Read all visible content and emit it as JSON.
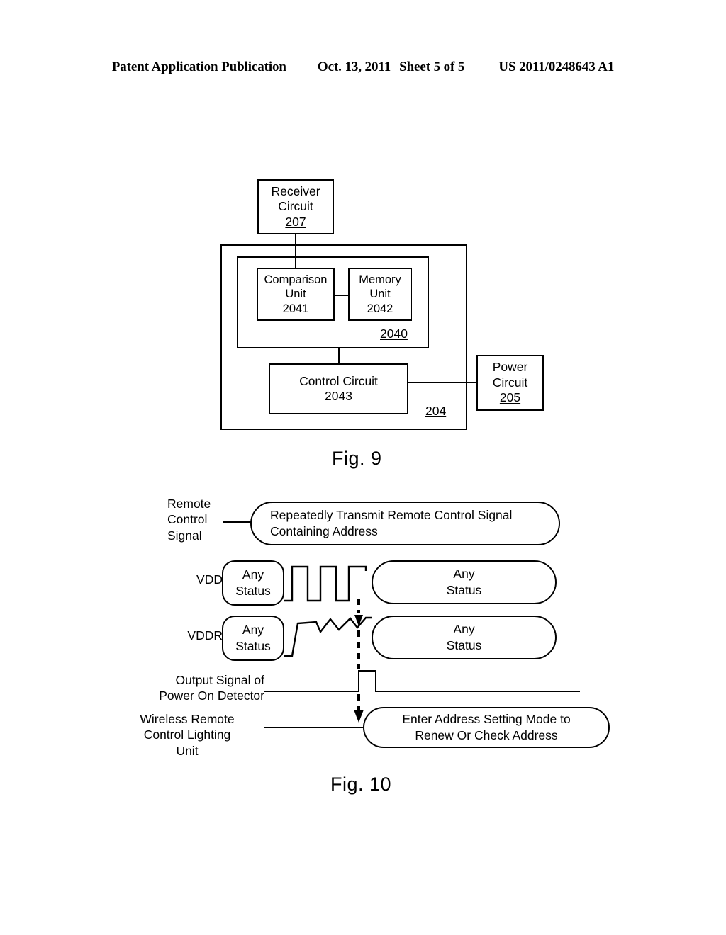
{
  "header": {
    "publication": "Patent Application Publication",
    "date": "Oct. 13, 2011",
    "sheet": "Sheet 5 of 5",
    "document_number": "US 2011/0248643 A1"
  },
  "figures": [
    {
      "caption": "Fig. 9",
      "blocks": [
        {
          "name": "receiver-circuit",
          "line1": "Receiver",
          "line2": "Circuit",
          "ref": "207"
        },
        {
          "name": "comparison-unit",
          "line1": "Comparison",
          "line2": "Unit",
          "ref": "2041"
        },
        {
          "name": "memory-unit",
          "line1": "Memory",
          "line2": "Unit",
          "ref": "2042"
        },
        {
          "name": "control-circuit",
          "line1": "Control Circuit",
          "line2": "",
          "ref": "2043"
        },
        {
          "name": "power-circuit",
          "line1": "Power",
          "line2": "Circuit",
          "ref": "205"
        }
      ],
      "group_refs": [
        {
          "name": "address-processing-group",
          "ref": "2040"
        },
        {
          "name": "controller-group",
          "ref": "204"
        }
      ]
    },
    {
      "caption": "Fig. 10",
      "rows": [
        {
          "label": "Remote\nControl\nSignal",
          "content": "Repeatedly Transmit Remote Control Signal\nContaining Address"
        },
        {
          "label": "VDD",
          "left_state": "Any\nStatus",
          "right_state": "Any\nStatus",
          "waveform": "square-pulses"
        },
        {
          "label": "VDDR",
          "left_state": "Any\nStatus",
          "right_state": "Any\nStatus",
          "waveform": "sawtooth-ramp"
        },
        {
          "label": "Output Signal of\nPower On Detector",
          "waveform": "single-pulse"
        },
        {
          "label": "Wireless Remote\nControl Lighting\nUnit",
          "content": "Enter Address Setting Mode to\nRenew Or Check Address"
        }
      ]
    }
  ]
}
